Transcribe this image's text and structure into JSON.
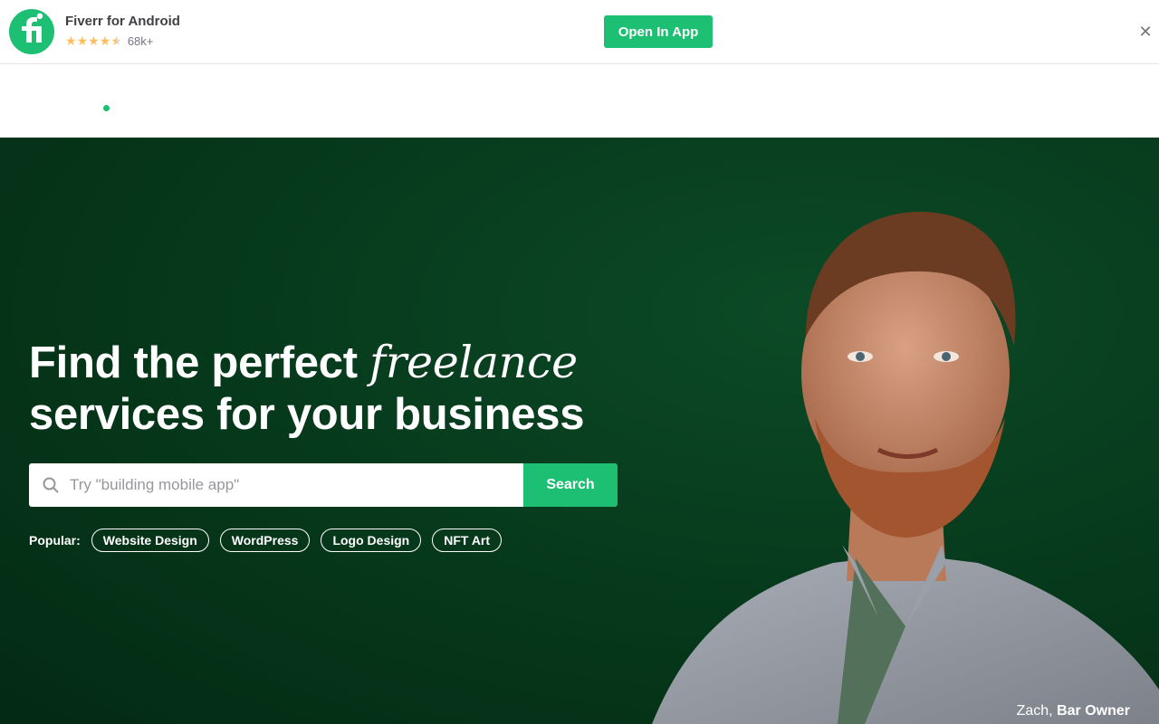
{
  "banner": {
    "app_name": "Fiverr for Android",
    "rating_stars": 4.5,
    "rating_count": "68k+",
    "open_button": "Open In App",
    "close_icon": "close-icon",
    "brand_color": "#1dbf73"
  },
  "hero": {
    "title_part1": "Find the perfect ",
    "title_accent": "freelance",
    "title_part2": "services for your business",
    "search": {
      "placeholder": "Try \"building mobile app\"",
      "value": "",
      "button_label": "Search",
      "icon": "search-icon"
    },
    "popular_label": "Popular:",
    "popular_tags": [
      "Website Design",
      "WordPress",
      "Logo Design",
      "NFT Art"
    ],
    "caption_name": "Zach,",
    "caption_role": "Bar Owner",
    "background_color": "#073b1d"
  }
}
